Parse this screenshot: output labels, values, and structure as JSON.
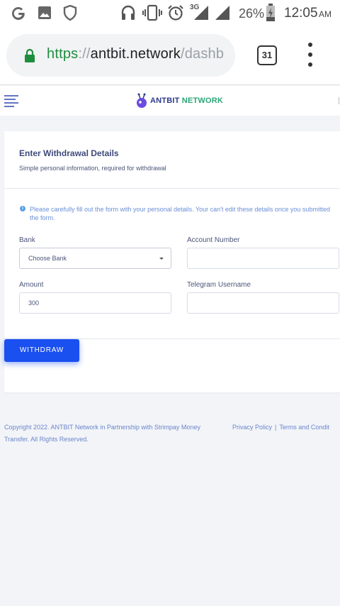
{
  "status_bar": {
    "icons": [
      "google-icon",
      "gallery-icon",
      "shield-icon",
      "headphones-icon",
      "vibrate-icon",
      "alarm-icon",
      "signal-3g-icon",
      "signal-icon",
      "battery-charging-icon"
    ],
    "network_label": "3G",
    "battery": "26%",
    "time": "12:05",
    "ampm": "AM"
  },
  "browser": {
    "url_scheme": "https",
    "url_sep": "://",
    "url_host": "antbit.network",
    "url_path": "/dashb",
    "tab_count": "31"
  },
  "header": {
    "brand_part1": "ANTBIT ",
    "brand_part2": "NETWORK"
  },
  "form": {
    "title": "Enter Withdrawal Details",
    "subtitle": "Simple personal information, required for withdrawal",
    "notice": "Please carefully fill out the form with your personal details. Your can't edit these details once you submitted the form.",
    "bank_label": "Bank",
    "bank_value": "Choose Bank",
    "account_label": "Account Number",
    "account_value": "",
    "amount_label": "Amount",
    "amount_value": "300",
    "telegram_label": "Telegram Username",
    "telegram_value": "",
    "submit_label": "WITHDRAW"
  },
  "footer": {
    "copyright": "Copyright 2022. ANTBIT Network in Partnership with Strimpay Money Transfer. All Rights Reserved.",
    "privacy": "Privacy Policy",
    "separator": "|",
    "terms": "Terms and Condit"
  },
  "colors": {
    "accent": "#1a4ff0",
    "brand_dark": "#2e3a8c",
    "brand_green": "#2aa676",
    "link": "#6b85c9",
    "url_green": "#1e8e3e"
  }
}
